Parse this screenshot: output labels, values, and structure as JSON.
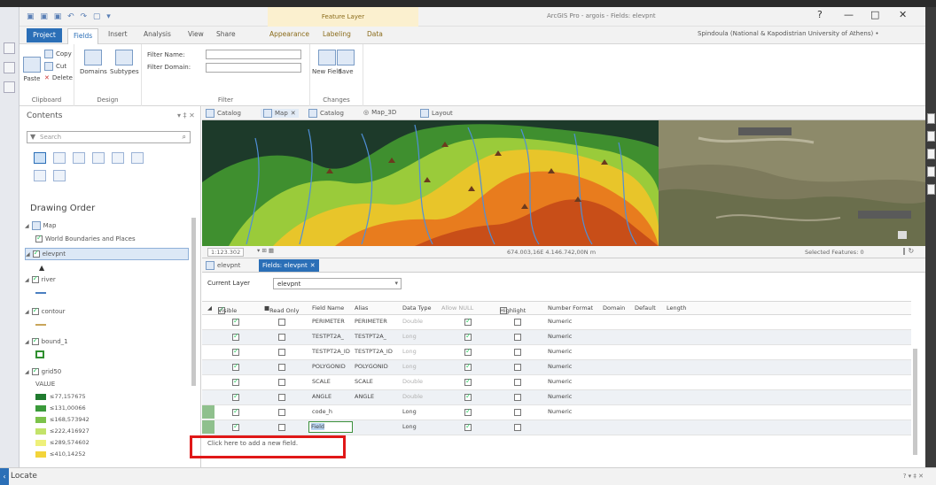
{
  "title_bar": {
    "quick_access": "▣ ▣ ▣ ↶ ↷ ▢ ▾",
    "context_tab": "Feature Layer",
    "app_title": "ArcGIS Pro - argois - Fields: elevpnt",
    "help": "?",
    "minimize": "—",
    "maximize": "□",
    "close": "✕"
  },
  "ribbon_tabs": [
    "Project",
    "Fields",
    "Insert",
    "Analysis",
    "View",
    "Share",
    "Appearance",
    "Labeling",
    "Data"
  ],
  "user": "Spindoula (National & Kapodistrian University of Athens) •",
  "ribbon": {
    "clipboard": {
      "paste": "Paste",
      "copy": "Copy",
      "cut": "Cut",
      "delete": "Delete",
      "label": "Clipboard"
    },
    "design": {
      "domains": "Domains",
      "subtypes": "Subtypes",
      "label": "Design"
    },
    "filter": {
      "name_label": "Filter Name:",
      "domain_label": "Filter Domain:",
      "label": "Filter"
    },
    "changes": {
      "new_field": "New Field",
      "save": "Save",
      "label": "Changes"
    }
  },
  "contents": {
    "title": "Contents",
    "controls": "▾ ‡ ✕",
    "search_placeholder": "Search",
    "drawing_order": "Drawing Order",
    "layers": {
      "map": "Map",
      "world": "World Boundaries and Places",
      "elevpnt": "elevpnt",
      "river": "river",
      "contour": "contour",
      "bound": "bound_1",
      "grid": "grid50",
      "value": "VALUE"
    },
    "legend": [
      {
        "label": "≤77,157675",
        "color": "#1f7a2e"
      },
      {
        "label": "≤131,00066",
        "color": "#3a9a3a"
      },
      {
        "label": "≤168,573942",
        "color": "#7cc24a"
      },
      {
        "label": "≤222,416927",
        "color": "#c3e36a"
      },
      {
        "label": "≤289,574602",
        "color": "#eef07a"
      },
      {
        "label": "≤410,14252",
        "color": "#f3d43a"
      }
    ]
  },
  "map_tabs": [
    "Catalog",
    "Map",
    "Catalog",
    "Map_3D",
    "Layout"
  ],
  "map_status": {
    "scale": "1:123.302",
    "coords": "674.003,16E 4.146.742,00N m",
    "selected": "Selected Features: 0"
  },
  "view_tabs": {
    "tab1": "elevpnt",
    "tab2": "Fields: elevpnt"
  },
  "current_layer": {
    "label": "Current Layer",
    "value": "elevpnt"
  },
  "grid_headers": {
    "visible": "Visible",
    "readonly": "Read Only",
    "name": "Field Name",
    "alias": "Alias",
    "type": "Data Type",
    "nulls": "Allow NULL",
    "highlight": "Highlight",
    "format": "Number Format",
    "domain": "Domain",
    "default": "Default",
    "length": "Length"
  },
  "rows": [
    {
      "name": "PERIMETER",
      "alias": "PERIMETER",
      "type": "Double",
      "format": "Numeric"
    },
    {
      "name": "TESTPT2A_",
      "alias": "TESTPT2A_",
      "type": "Long",
      "format": "Numeric"
    },
    {
      "name": "TESTPT2A_ID",
      "alias": "TESTPT2A_ID",
      "type": "Long",
      "format": "Numeric"
    },
    {
      "name": "POLYGONID",
      "alias": "POLYGONID",
      "type": "Long",
      "format": "Numeric"
    },
    {
      "name": "SCALE",
      "alias": "SCALE",
      "type": "Double",
      "format": "Numeric"
    },
    {
      "name": "ANGLE",
      "alias": "ANGLE",
      "type": "Double",
      "format": "Numeric"
    },
    {
      "name": "code_h",
      "alias": "",
      "type": "Long",
      "format": "Numeric"
    },
    {
      "name": "Field",
      "alias": "",
      "type": "Long",
      "format": ""
    }
  ],
  "add_field_text": "Click here to add a new field.",
  "locate": {
    "label": "Locate",
    "controls": "? ▾ ‡ ✕"
  },
  "colors": {
    "accent": "#2b6fb7",
    "highlight_box": "#e01818",
    "context": "#fbf0cf"
  }
}
